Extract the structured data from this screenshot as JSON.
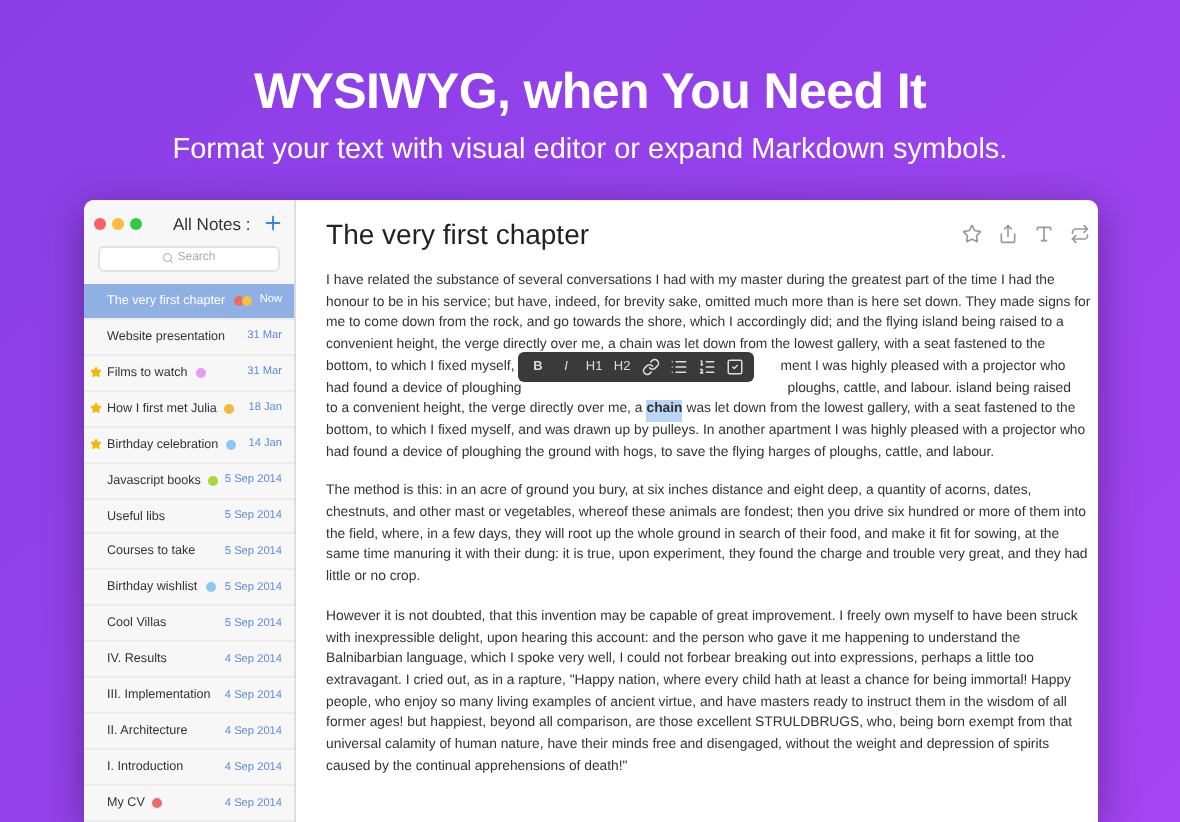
{
  "headline": "WYSIWYG, when You Need It",
  "subheadline": "Format your text with visual editor or expand Markdown symbols.",
  "sidebar": {
    "title": "All Notes",
    "title_caret": ":",
    "search": {
      "placeholder": "Search"
    },
    "notes": [
      {
        "title": "The very first chapter",
        "date": "Now",
        "starred": false,
        "color": "#f06a6a",
        "second_tag": {
          "color": "#f5c142"
        },
        "selected": true
      },
      {
        "title": "Website presentation",
        "date": "31 Mar",
        "starred": false,
        "selected": false
      },
      {
        "title": "Films to watch",
        "date": "31 Mar",
        "starred": true,
        "color": "#e79cf0",
        "selected": false
      },
      {
        "title": "How I first met Julia",
        "date": "18 Jan",
        "starred": true,
        "color": "#f5b93a",
        "selected": false
      },
      {
        "title": "Birthday celebration",
        "date": "14 Jan",
        "starred": true,
        "color": "#8cc8f5",
        "selected": false
      },
      {
        "title": "Javascript books",
        "date": "5 Sep 2014",
        "starred": false,
        "color": "#a6d83c",
        "selected": false
      },
      {
        "title": "Useful libs",
        "date": "5 Sep 2014",
        "starred": false,
        "selected": false
      },
      {
        "title": "Courses to take",
        "date": "5 Sep 2014",
        "starred": false,
        "selected": false
      },
      {
        "title": "Birthday wishlist",
        "date": "5 Sep 2014",
        "starred": false,
        "color": "#8cc8f5",
        "selected": false
      },
      {
        "title": "Cool Villas",
        "date": "5 Sep 2014",
        "starred": false,
        "selected": false
      },
      {
        "title": "IV. Results",
        "date": "4 Sep 2014",
        "starred": false,
        "selected": false
      },
      {
        "title": "III. Implementation",
        "date": "4 Sep 2014",
        "starred": false,
        "selected": false
      },
      {
        "title": "II. Architecture",
        "date": "4 Sep 2014",
        "starred": false,
        "selected": false
      },
      {
        "title": "I. Introduction",
        "date": "4 Sep 2014",
        "starred": false,
        "selected": false
      },
      {
        "title": "My CV",
        "date": "4 Sep 2014",
        "starred": false,
        "color": "#f06a6a",
        "selected": false
      }
    ]
  },
  "editor": {
    "title": "The very first chapter",
    "toolbar": [
      {
        "kind": "text",
        "label": "B"
      },
      {
        "kind": "text",
        "label": "I"
      },
      {
        "kind": "text",
        "label": "H1"
      },
      {
        "kind": "text",
        "label": "H2"
      },
      {
        "kind": "link"
      },
      {
        "kind": "bullets"
      },
      {
        "kind": "numbers"
      },
      {
        "kind": "checkbox"
      }
    ],
    "paragraphs": [
      [
        {
          "kind": "plain",
          "text": "I have related the substance of several conversations I had with my master during the greatest part of the time I had the"
        },
        {
          "kind": "plain",
          "text": "honour to be in his service; but have, indeed, for brevity sake, omitted much more than is here set down. They made signs for"
        },
        {
          "kind": "plain",
          "text": "me to come down from the rock, and go towards the shore, which I accordingly did; and the flying island being raised to a"
        },
        {
          "kind": "plain",
          "text": "convenient height, the verge directly over me, a chain was let down from the lowest gallery, with a seat fastened to the"
        },
        {
          "kind": "split",
          "left": "bottom, to which I fixed myself,",
          "right": "ment I was highly pleased with a projector who"
        },
        {
          "kind": "split",
          "left": "had found a device of ploughing",
          "right": "ploughs, cattle, and labour. island being raised"
        },
        {
          "kind": "selection",
          "before": "to a convenient height, the verge directly over me, a",
          "selected": "chain",
          "after": "was let down from the lowest gallery, with a seat fastened to the"
        },
        {
          "kind": "plain",
          "text": "bottom, to which I fixed myself, and was drawn up by pulleys. In another apartment I was highly pleased with a projector who"
        },
        {
          "kind": "plain",
          "text": "had found a device of ploughing the ground with hogs, to save the flying harges of ploughs, cattle, and labour."
        }
      ],
      [
        {
          "kind": "plain",
          "text": "The method is this: in an acre of ground you bury, at six inches distance and eight deep, a quantity of acorns, dates,"
        },
        {
          "kind": "plain",
          "text": "chestnuts, and other mast or vegetables, whereof these animals are fondest; then you drive six hundred or more of them into"
        },
        {
          "kind": "plain",
          "text": "the field, where, in a few days, they will root up the whole ground in search of their food, and make it fit for sowing, at the"
        },
        {
          "kind": "plain",
          "text": "same time manuring it with their dung: it is true, upon experiment, they found the charge and trouble very great, and they had"
        },
        {
          "kind": "plain",
          "text": "little or no crop."
        }
      ],
      [
        {
          "kind": "plain",
          "text": "However it is not doubted, that this invention may be capable of great improvement. I freely own myself to have been struck"
        },
        {
          "kind": "plain",
          "text": "with inexpressible delight, upon hearing this account: and the person who gave it me happening to understand the"
        },
        {
          "kind": "plain",
          "text": "Balnibarbian language, which I spoke very well, I could not forbear breaking out into expressions, perhaps a little too"
        },
        {
          "kind": "plain",
          "text": "extravagant. I cried out, as in a rapture, \"Happy nation, where every child hath at least a chance for being immortal! Happy"
        },
        {
          "kind": "plain",
          "text": "people, who enjoy so many living examples of ancient virtue, and have masters ready to instruct them in the wisdom of all"
        },
        {
          "kind": "plain",
          "text": "former ages! but happiest, beyond all comparison, are those excellent STRULDBRUGS, who, being born exempt from that"
        },
        {
          "kind": "plain",
          "text": "universal calamity of human nature, have their minds free and disengaged, without the weight and depression of spirits"
        },
        {
          "kind": "plain",
          "text": "caused by the continual apprehensions of death!\""
        }
      ]
    ]
  }
}
